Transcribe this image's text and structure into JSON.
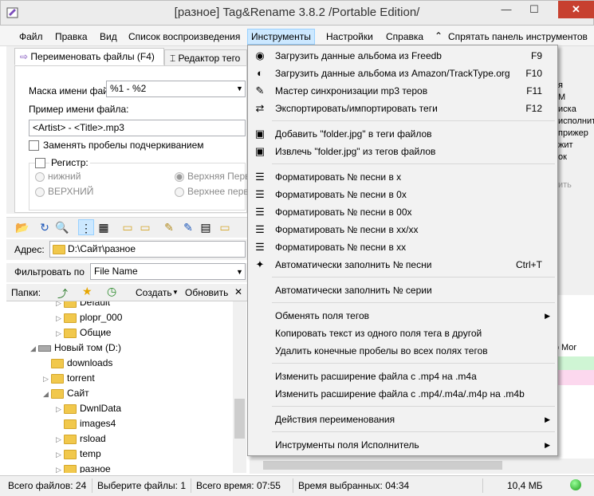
{
  "window": {
    "title": "[разное] Tag&Rename 3.8.2 /Portable Edition/",
    "minimize": "—",
    "maximize": "☐",
    "close": "✕"
  },
  "menu": [
    "Файл",
    "Правка",
    "Вид",
    "Список воспроизведения",
    "Инструменты",
    "Настройки",
    "Справка",
    "Спрятать панель инструментов"
  ],
  "tabs": {
    "rename": "Переименовать файлы (F4)",
    "editor": "Редактор тего"
  },
  "rename": {
    "mask_label": "Маска имени фай",
    "mask_value": "%1 - %2",
    "example_label": "Пример имени файла:",
    "example_value": "<Artist> - <Title>.mp3",
    "replace_spaces": "Заменять пробелы подчеркиванием",
    "case_group": "Регистр:",
    "lower": "нижний",
    "upper": "ВЕРХНИЙ",
    "title_upper": "Верхняя Перв",
    "title_lower": "Верхнее перв"
  },
  "address": {
    "label": "Адрес:",
    "value": "D:\\Сайт\\разное"
  },
  "filter": {
    "label": "Фильтровать по",
    "value": "File Name"
  },
  "folders": {
    "label": "Папки:",
    "create": "Создать",
    "refresh": "Обновить",
    "close": "✕"
  },
  "tree": [
    {
      "label": "Default",
      "indent": 4,
      "arrow": "▷"
    },
    {
      "label": "plopr_000",
      "indent": 4,
      "arrow": "▷"
    },
    {
      "label": "Общие",
      "indent": 4,
      "arrow": "▷"
    },
    {
      "label": "Новый том (D:)",
      "indent": 2,
      "arrow": "◢",
      "drive": true
    },
    {
      "label": "downloads",
      "indent": 3,
      "arrow": ""
    },
    {
      "label": "torrent",
      "indent": 3,
      "arrow": "▷"
    },
    {
      "label": "Сайт",
      "indent": 3,
      "arrow": "◢"
    },
    {
      "label": "DwnlData",
      "indent": 4,
      "arrow": "▷"
    },
    {
      "label": "images4",
      "indent": 4,
      "arrow": ""
    },
    {
      "label": "rsload",
      "indent": 4,
      "arrow": "▷"
    },
    {
      "label": "temp",
      "indent": 4,
      "arrow": "▷"
    },
    {
      "label": "разное",
      "indent": 4,
      "arrow": "▷"
    }
  ],
  "right_fragments": [
    "я",
    "М",
    "иска",
    "исполнит",
    "прижер",
    "жит",
    "ок",
    "ить"
  ],
  "right_list_fragment": "lip Mor",
  "status": {
    "files_total": "Всего файлов: 24",
    "select_files": "Выберите файлы: 1",
    "time_total": "Всего время: 07:55",
    "time_selected": "Время выбранных: 04:34",
    "size": "10,4 МБ"
  },
  "tools_menu": [
    {
      "label": "Загрузить данные альбома из Freedb",
      "shortcut": "F9",
      "icon": "◉"
    },
    {
      "label": "Загрузить данные альбома из Amazon/TrackType.org",
      "shortcut": "F10",
      "icon": "◐"
    },
    {
      "label": "Мастер синхронизации mp3 теров",
      "shortcut": "F11",
      "icon": "✎"
    },
    {
      "label": "Экспортировать/импортировать теги",
      "shortcut": "F12",
      "icon": "⇄"
    },
    {
      "sep": true
    },
    {
      "label": "Добавить \"folder.jpg\" в теги файлов",
      "shortcut": "",
      "icon": "▣"
    },
    {
      "label": "Извлечь \"folder.jpg\" из тегов файлов",
      "shortcut": "",
      "icon": "▣"
    },
    {
      "sep": true
    },
    {
      "label": "Форматировать № песни в x",
      "shortcut": "",
      "icon": "☰"
    },
    {
      "label": "Форматировать № песни в 0x",
      "shortcut": "",
      "icon": "☰"
    },
    {
      "label": "Форматировать № песни в 00x",
      "shortcut": "",
      "icon": "☰"
    },
    {
      "label": "Форматировать № песни в xx/xx",
      "shortcut": "",
      "icon": "☰"
    },
    {
      "label": "Форматировать № песни в xx",
      "shortcut": "",
      "icon": "☰"
    },
    {
      "label": "Автоматически заполнить № песни",
      "shortcut": "Ctrl+T",
      "icon": "✦"
    },
    {
      "sep": true
    },
    {
      "label": "Автоматически заполнить № серии",
      "shortcut": "",
      "icon": ""
    },
    {
      "sep": true
    },
    {
      "label": "Обменять поля тегов",
      "shortcut": "",
      "icon": "",
      "sub": true
    },
    {
      "label": "Копировать текст из одного поля тега в другой",
      "shortcut": "",
      "icon": ""
    },
    {
      "label": "Удалить конечные пробелы во всех полях тегов",
      "shortcut": "",
      "icon": ""
    },
    {
      "sep": true
    },
    {
      "label": "Изменить расширение файла с .mp4 на .m4a",
      "shortcut": "",
      "icon": ""
    },
    {
      "label": "Изменить расширение файла с .mp4/.m4a/.m4p на .m4b",
      "shortcut": "",
      "icon": ""
    },
    {
      "sep": true
    },
    {
      "label": "Действия переименования",
      "shortcut": "",
      "icon": "",
      "sub": true
    },
    {
      "sep": true
    },
    {
      "label": "Инструменты поля Исполнитель",
      "shortcut": "",
      "icon": "",
      "sub": true
    }
  ],
  "colors": {
    "menu_highlight": "#cce8ff",
    "close_button": "#c7402f",
    "status_ok": "#22aa22"
  }
}
